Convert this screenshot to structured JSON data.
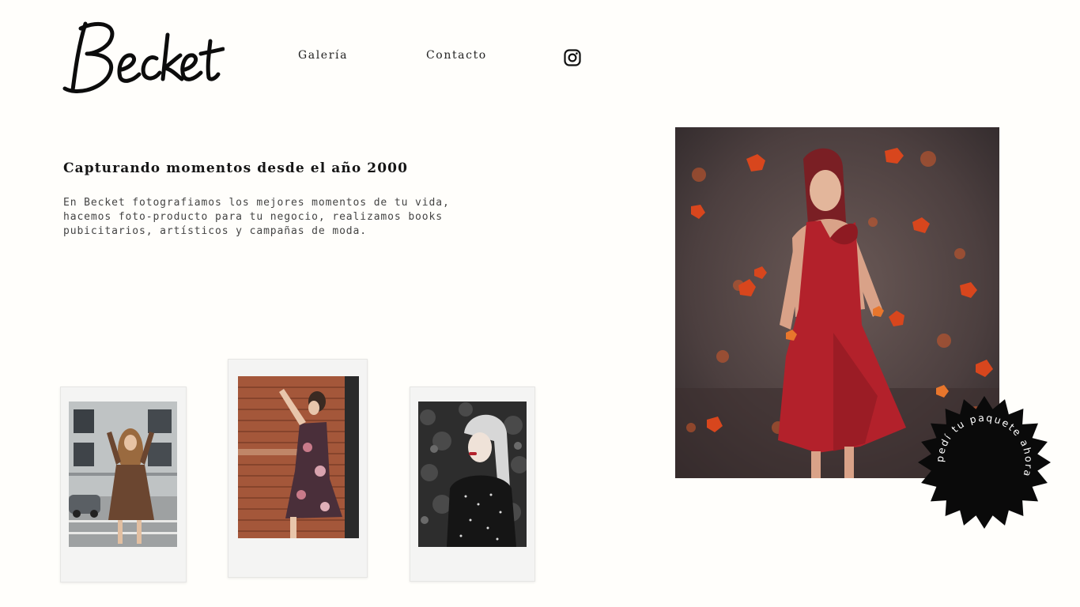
{
  "header": {
    "logo_text": "Becket",
    "nav": [
      {
        "label": "Galería"
      },
      {
        "label": "Contacto"
      }
    ],
    "social_icon": "instagram-icon"
  },
  "hero": {
    "title": "Capturando momentos desde el año 2000",
    "body": "En Becket fotografiamos los mejores momentos de tu vida, hacemos foto-producto para tu negocio, realizamos books pubicitarios, artísticos y campañas de moda."
  },
  "gallery": {
    "polaroids": [
      {
        "subject": "woman in brown dress on street"
      },
      {
        "subject": "woman in floral dress against brick wall"
      },
      {
        "subject": "woman with silver hair in polka-dot top"
      }
    ]
  },
  "featured": {
    "subject": "woman in red dress with falling autumn leaves"
  },
  "badge": {
    "text": "pedí tu paquete ahora",
    "color": "#0a0a0a"
  },
  "colors": {
    "background": "#fffefb",
    "text": "#151515",
    "accent_red": "#b3212b"
  }
}
